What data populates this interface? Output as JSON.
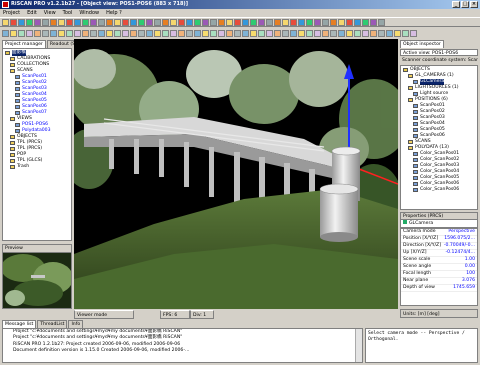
{
  "window": {
    "title": "RiSCAN PRO v1.2.1b27 - [Object view: POS1-POS6 (883 x 718)]",
    "controls": [
      "_",
      "□",
      "×"
    ]
  },
  "menu": [
    "Project",
    "Edit",
    "View",
    "Tool",
    "Window",
    "Help ?"
  ],
  "left_panel": {
    "tabs": [
      "Project manager",
      "Readout (SOCS)"
    ],
    "tree": [
      {
        "label": "面影橋",
        "indent": 0,
        "selected": true
      },
      {
        "label": "CALIBRATIONS",
        "indent": 1
      },
      {
        "label": "COLLECTIONS",
        "indent": 1
      },
      {
        "label": "SCANS",
        "indent": 1
      },
      {
        "label": "ScanPos01",
        "indent": 2,
        "blue": true
      },
      {
        "label": "ScanPos02",
        "indent": 2,
        "blue": true
      },
      {
        "label": "ScanPos03",
        "indent": 2,
        "blue": true
      },
      {
        "label": "ScanPos04",
        "indent": 2,
        "blue": true
      },
      {
        "label": "ScanPos05",
        "indent": 2,
        "blue": true
      },
      {
        "label": "ScanPos06",
        "indent": 2,
        "blue": true
      },
      {
        "label": "ScanPos07",
        "indent": 2,
        "blue": true
      },
      {
        "label": "VIEWS",
        "indent": 1
      },
      {
        "label": "POS1-POS6",
        "indent": 2,
        "blue": true
      },
      {
        "label": "Polydata003",
        "indent": 2,
        "blue": true
      },
      {
        "label": "OBJECTS",
        "indent": 1
      },
      {
        "label": "TPL (PRCS)",
        "indent": 1
      },
      {
        "label": "TPL (PRCS)",
        "indent": 1
      },
      {
        "label": "POP",
        "indent": 1
      },
      {
        "label": "TPL (GLCS)",
        "indent": 1
      },
      {
        "label": "Trash",
        "indent": 1
      }
    ],
    "preview_label": "Preview"
  },
  "viewport": {
    "status": [
      "Viewer mode",
      "FPS: 6",
      "Div: 1"
    ]
  },
  "right_panel": {
    "tab": "Object inspector",
    "active_view_label": "Active view: POS1-POS6",
    "scanner_label": "Scanner coordinate system: ScanPos07",
    "tree": [
      {
        "label": "OBJECTS",
        "indent": 0
      },
      {
        "label": "GL_CAMERAS (1)",
        "indent": 1
      },
      {
        "label": "GLCamera",
        "indent": 2,
        "selected": true
      },
      {
        "label": "LIGHTSOURCES (1)",
        "indent": 1
      },
      {
        "label": "Light source",
        "indent": 2
      },
      {
        "label": "POSITIONS (6)",
        "indent": 1
      },
      {
        "label": "ScanPos01",
        "indent": 2
      },
      {
        "label": "ScanPos02",
        "indent": 2
      },
      {
        "label": "ScanPos03",
        "indent": 2
      },
      {
        "label": "ScanPos04",
        "indent": 2
      },
      {
        "label": "ScanPos05",
        "indent": 2
      },
      {
        "label": "ScanPos06",
        "indent": 2
      },
      {
        "label": "SCANS",
        "indent": 1
      },
      {
        "label": "POLYDATA (13)",
        "indent": 1
      },
      {
        "label": "Color_ScanPos01",
        "indent": 2
      },
      {
        "label": "Color_ScanPos02",
        "indent": 2
      },
      {
        "label": "Color_ScanPos03",
        "indent": 2
      },
      {
        "label": "Color_ScanPos04",
        "indent": 2
      },
      {
        "label": "Color_ScanPos05",
        "indent": 2
      },
      {
        "label": "Color_ScanPos06",
        "indent": 2
      },
      {
        "label": "Color_ScanPos06",
        "indent": 2
      }
    ],
    "properties_title": "Properties (PRCS)",
    "properties_object": "GLCamera",
    "properties": [
      {
        "key": "Camera mode",
        "value": "Perspective"
      },
      {
        "key": "Position [X/Y/Z]",
        "value": "1596.075/2..."
      },
      {
        "key": "Direction [X/Y/Z]",
        "value": "-0.70049/-0..."
      },
      {
        "key": "Up [X/Y/Z]",
        "value": "-0.12474/4..."
      },
      {
        "key": "Scene scale",
        "value": "1.00"
      },
      {
        "key": "Scene angle",
        "value": "0.00"
      },
      {
        "key": "Focal length",
        "value": "100"
      },
      {
        "key": "Near plane",
        "value": "3.076"
      },
      {
        "key": "Depth of view",
        "value": "1745.659"
      }
    ],
    "units": "Units: [m] [deg]"
  },
  "messages": {
    "tabs": [
      "Message list",
      "ThreadList",
      "Info"
    ],
    "lines": [
      "Project \"c:¥documents and settings¥myd¥my documents¥面影橋 RiSCAN\"",
      "Project \"c:¥documents and settings¥myd¥my documents¥面影橋 RiSCAN\"",
      "RiSCAN PRO 1.2.1b27: Project created 2006-09-06, modified 2006-09-06",
      "Document definition version is 1.15.0 Created 2006-09-06, modified 2006-..."
    ]
  },
  "help_text": "Select camera mode -- Perspective /\nOrthogonal.",
  "colors": {
    "title_start": "#0a246a",
    "title_end": "#a6caf0",
    "selection": "#0a246a",
    "axis_z": "#2030ff",
    "axis_x": "#ff2020"
  }
}
